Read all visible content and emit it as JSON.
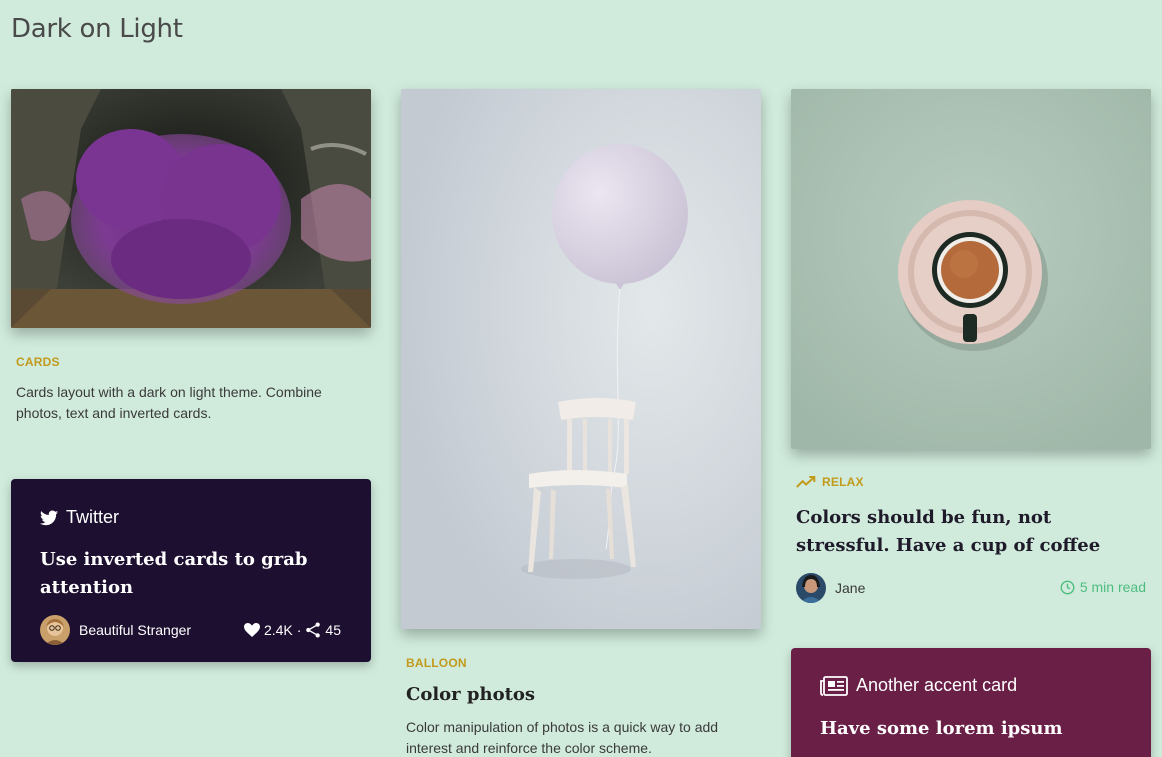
{
  "page": {
    "title": "Dark on Light"
  },
  "colors": {
    "background": "#d0ebdc",
    "accent_tag": "#c29a1c",
    "twitter_card": "#1d0f30",
    "accent_card": "#6a1f46",
    "read_time": "#4dbd7f"
  },
  "cards_card": {
    "tag": "CARDS",
    "description": "Cards layout with a dark on light theme. Combine photos, text and inverted cards."
  },
  "twitter_card": {
    "icon": "twitter-bird-icon",
    "label": "Twitter",
    "title": "Use inverted cards to grab attention",
    "author": "Beautiful Stranger",
    "likes": "2.4K",
    "separator": "·",
    "shares": "45"
  },
  "balloon_card": {
    "tag": "BALLOON",
    "title": "Color photos",
    "description": "Color manipulation of photos is a quick way to add interest and reinforce the color scheme."
  },
  "relax_card": {
    "tag_icon": "trending-up-icon",
    "tag": "RELAX",
    "title": "Colors should be fun, not stressful. Have a cup of coffee",
    "author": "Jane",
    "read_time": "5 min read"
  },
  "accent_card": {
    "icon": "newspaper-icon",
    "label": "Another accent card",
    "title": "Have some lorem ipsum"
  }
}
